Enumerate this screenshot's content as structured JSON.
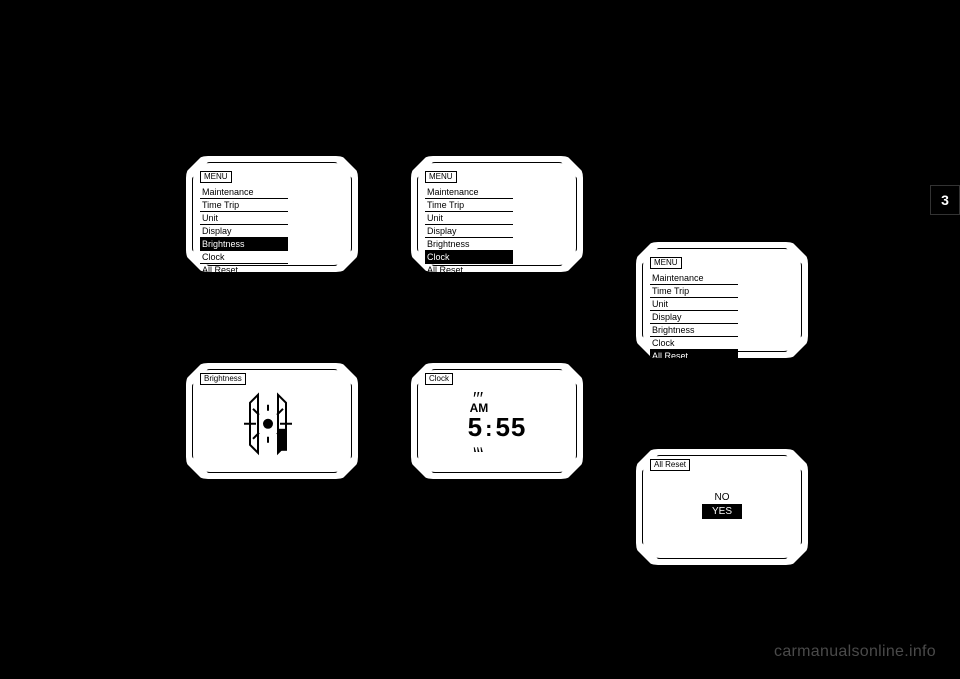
{
  "page_tab": "3",
  "menu_title": "MENU",
  "menu_items": [
    "Maintenance",
    "Time Trip",
    "Unit",
    "Display",
    "Brightness",
    "Clock",
    "All Reset"
  ],
  "panel1": {
    "selected_index": 4
  },
  "panel2": {
    "selected_index": 5
  },
  "panel3": {
    "selected_index": 6
  },
  "brightness": {
    "title": "Brightness"
  },
  "clock": {
    "title": "Clock",
    "ampm": "AM",
    "hour": "5",
    "minute": "55"
  },
  "all_reset": {
    "title": "All Reset",
    "options": [
      "NO",
      "YES"
    ],
    "selected_index": 1
  },
  "watermark": "carmanualsonline.info"
}
